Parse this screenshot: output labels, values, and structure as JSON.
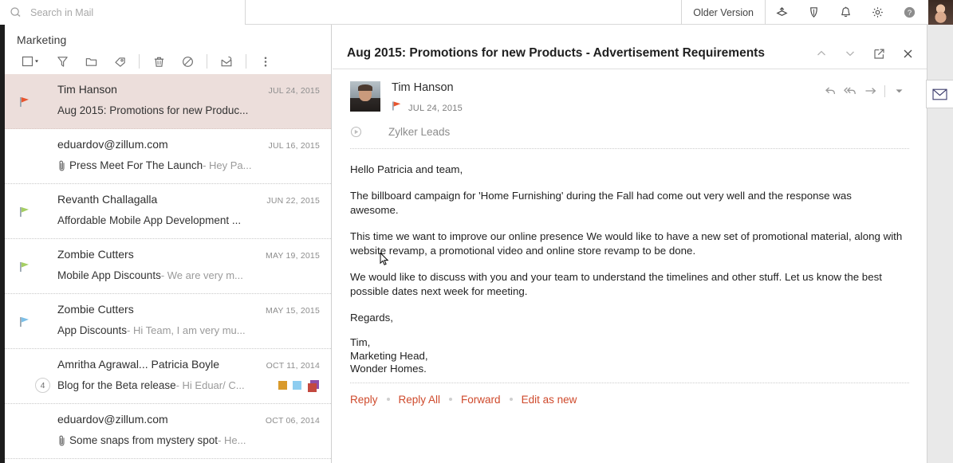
{
  "topbar": {
    "search_placeholder": "Search in Mail",
    "search_value": "",
    "older_version_label": "Older Version",
    "icons": [
      "layers-icon",
      "feather-icon",
      "bell-icon",
      "gear-icon",
      "help-icon",
      "avatar"
    ]
  },
  "list_pane": {
    "folder_title": "Marketing",
    "toolbar": [
      {
        "name": "select-all-checkbox",
        "label": "Select"
      },
      {
        "name": "filter-icon",
        "label": "Filter"
      },
      {
        "name": "folder-icon",
        "label": "Move to folder"
      },
      {
        "name": "tag-icon",
        "label": "Add tag"
      },
      {
        "name": "trash-icon",
        "label": "Delete"
      },
      {
        "name": "block-icon",
        "label": "Mark as spam"
      },
      {
        "name": "archive-icon",
        "label": "Archive"
      },
      {
        "name": "more-options-icon",
        "label": "More"
      }
    ],
    "emails": [
      {
        "sender": "Tim Hanson",
        "date": "JUL 24, 2015",
        "subject": "Aug 2015: Promotions for new Produc...",
        "snippet": "",
        "flag": "#e8552f",
        "selected": true,
        "attachment": false,
        "count": "",
        "tags": []
      },
      {
        "sender": "eduardov@zillum.com",
        "date": "JUL 16, 2015",
        "subject": "Press Meet For The Launch",
        "snippet": " - Hey Pa...",
        "flag": "",
        "selected": false,
        "attachment": true,
        "count": "",
        "tags": []
      },
      {
        "sender": "Revanth Challagalla",
        "date": "JUN 22, 2015",
        "subject": "Affordable Mobile App Development ...",
        "snippet": "",
        "flag": "#a5cf63",
        "selected": false,
        "attachment": false,
        "count": "",
        "tags": []
      },
      {
        "sender": "Zombie Cutters",
        "date": "MAY 19, 2015",
        "subject": "Mobile App Discounts",
        "snippet": " - We are very m...",
        "flag": "#a5cf63",
        "selected": false,
        "attachment": false,
        "count": "",
        "tags": []
      },
      {
        "sender": "Zombie Cutters",
        "date": "MAY 15, 2015",
        "subject": "App Discounts",
        "snippet": " - Hi Team, I am very mu...",
        "flag": "#7cc0e8",
        "selected": false,
        "attachment": false,
        "count": "",
        "tags": []
      },
      {
        "sender": "Amritha Agrawal... Patricia Boyle",
        "date": "OCT 11, 2014",
        "subject": "Blog for the Beta release",
        "snippet": " - Hi Eduar/ C...",
        "flag": "",
        "selected": false,
        "attachment": false,
        "count": "4",
        "tags": [
          "#d99a2b",
          "#8ecdf0",
          "stack"
        ]
      },
      {
        "sender": "eduardov@zillum.com",
        "date": "OCT 06, 2014",
        "subject": "Some snaps from mystery spot",
        "snippet": " - He...",
        "flag": "",
        "selected": false,
        "attachment": true,
        "count": "",
        "tags": []
      }
    ]
  },
  "read_pane": {
    "subject": "Aug 2015: Promotions for new Products - Advertisement Requirements",
    "header_buttons": [
      "prev-message-icon",
      "next-message-icon",
      "open-in-new-window-icon",
      "close-icon"
    ],
    "from": "Tim Hanson",
    "date": "JUL 24, 2015",
    "flag_color": "#e8552f",
    "folder": "Zylker Leads",
    "message_actions": [
      "reply-icon",
      "reply-all-icon",
      "forward-icon",
      "more-actions-caret"
    ],
    "body": [
      "Hello Patricia and team,",
      "The billboard campaign for 'Home Furnishing' during the Fall had come out very well and the response was awesome.",
      "This time we want to improve our online presence We would like to have a new set of promotional material, along with website revamp, a promotional video and online store revamp to be done.",
      "We would like to discuss with you and your team to understand the timelines and other stuff. Let us know the best possible dates next week for meeting.",
      "Regards,"
    ],
    "signature": [
      "Tim,",
      "Marketing Head,",
      "Wonder Homes."
    ],
    "actions": [
      "Reply",
      "Reply All",
      "Forward",
      "Edit as new"
    ],
    "accent_color": "#cf4a2c"
  },
  "right_rail": {
    "tab_icon": "mail-envelope-icon"
  }
}
